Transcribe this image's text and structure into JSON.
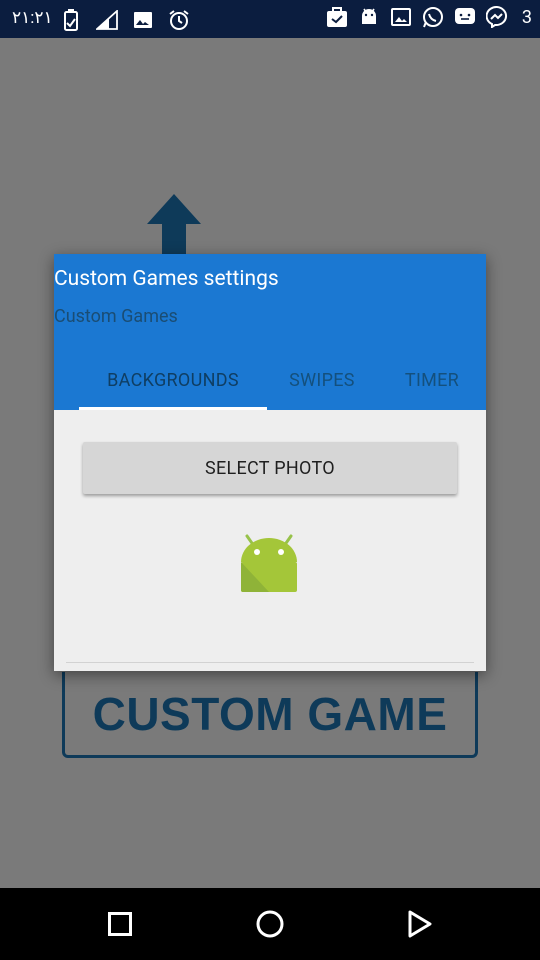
{
  "status_bar": {
    "time": "٢١:٢١",
    "notification_count": "3",
    "icons_left": [
      "battery-saver-icon",
      "signal-icon",
      "image-icon",
      "alarm-icon"
    ],
    "icons_right": [
      "bag-icon",
      "android-icon",
      "photo-icon",
      "whatsapp-icon",
      "chat-icon",
      "messenger-icon"
    ]
  },
  "background": {
    "banner_text": "CUSTOM GAME",
    "banner_color": "#0e3a59",
    "arrow_color": "#0e3a59"
  },
  "dialog": {
    "title": "Custom Games settings",
    "subtitle": "Custom Games",
    "header_color": "#1b78d2",
    "tabs": [
      {
        "label": "BACKGROUNDS",
        "active": true
      },
      {
        "label": "SWIPES",
        "active": false
      },
      {
        "label": "TIMER",
        "active": false
      }
    ],
    "select_button_label": "SELECT PHOTO",
    "placeholder_image": "android-robot-icon"
  },
  "nav_bar": {
    "buttons": [
      "recent-apps-icon",
      "home-icon",
      "back-icon"
    ]
  }
}
